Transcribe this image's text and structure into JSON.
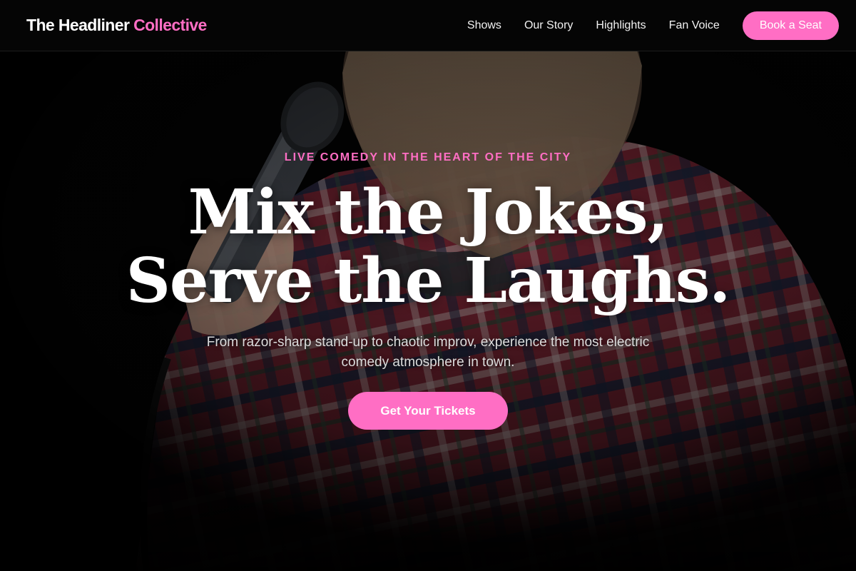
{
  "brand": {
    "name_main": "The Headliner",
    "name_accent": "Collective"
  },
  "nav": {
    "links": [
      "Shows",
      "Our Story",
      "Highlights",
      "Fan Voice"
    ],
    "cta": "Book a Seat"
  },
  "hero": {
    "eyebrow": "LIVE COMEDY IN THE HEART OF THE CITY",
    "headline_line1": "Mix the Jokes,",
    "headline_line2": "Serve the Laughs.",
    "subhead": "From razor-sharp stand-up to chaotic improv, experience the most electric comedy atmosphere in town.",
    "cta": "Get Your Tickets",
    "background_image": "comedian-with-microphone-photo"
  },
  "colors": {
    "accent": "#ff6ec4",
    "background": "#050505",
    "text": "#ffffff"
  }
}
